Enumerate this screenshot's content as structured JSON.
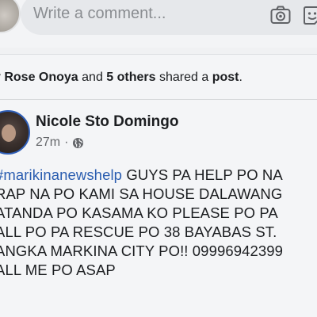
{
  "comment_bar": {
    "placeholder": "Write a comment...",
    "camera_icon": "camera-icon",
    "sticker_icon": "smiley-sticker-icon"
  },
  "share_header": {
    "actor_fragment": "y Rose Onoya",
    "and_text": " and ",
    "others": "5 others",
    "shared_text": " shared a ",
    "object": "post",
    "end": "."
  },
  "post": {
    "author": "Nicole Sto Domingo",
    "time": "27m",
    "separator": "·",
    "privacy_icon": "globe-icon",
    "hashtag": "marikinanewshelp",
    "lines": [
      "GUYS PA HELP PO NA",
      "RAP NA PO KAMI SA HOUSE DALAWANG",
      "ATANDA PO KASAMA KO PLEASE PO PA",
      "ALL PO PA RESCUE PO 38 BAYABAS ST.",
      "ANGKA MARKINA CITY PO!! 09996942399",
      "ALL ME PO ASAP"
    ]
  }
}
